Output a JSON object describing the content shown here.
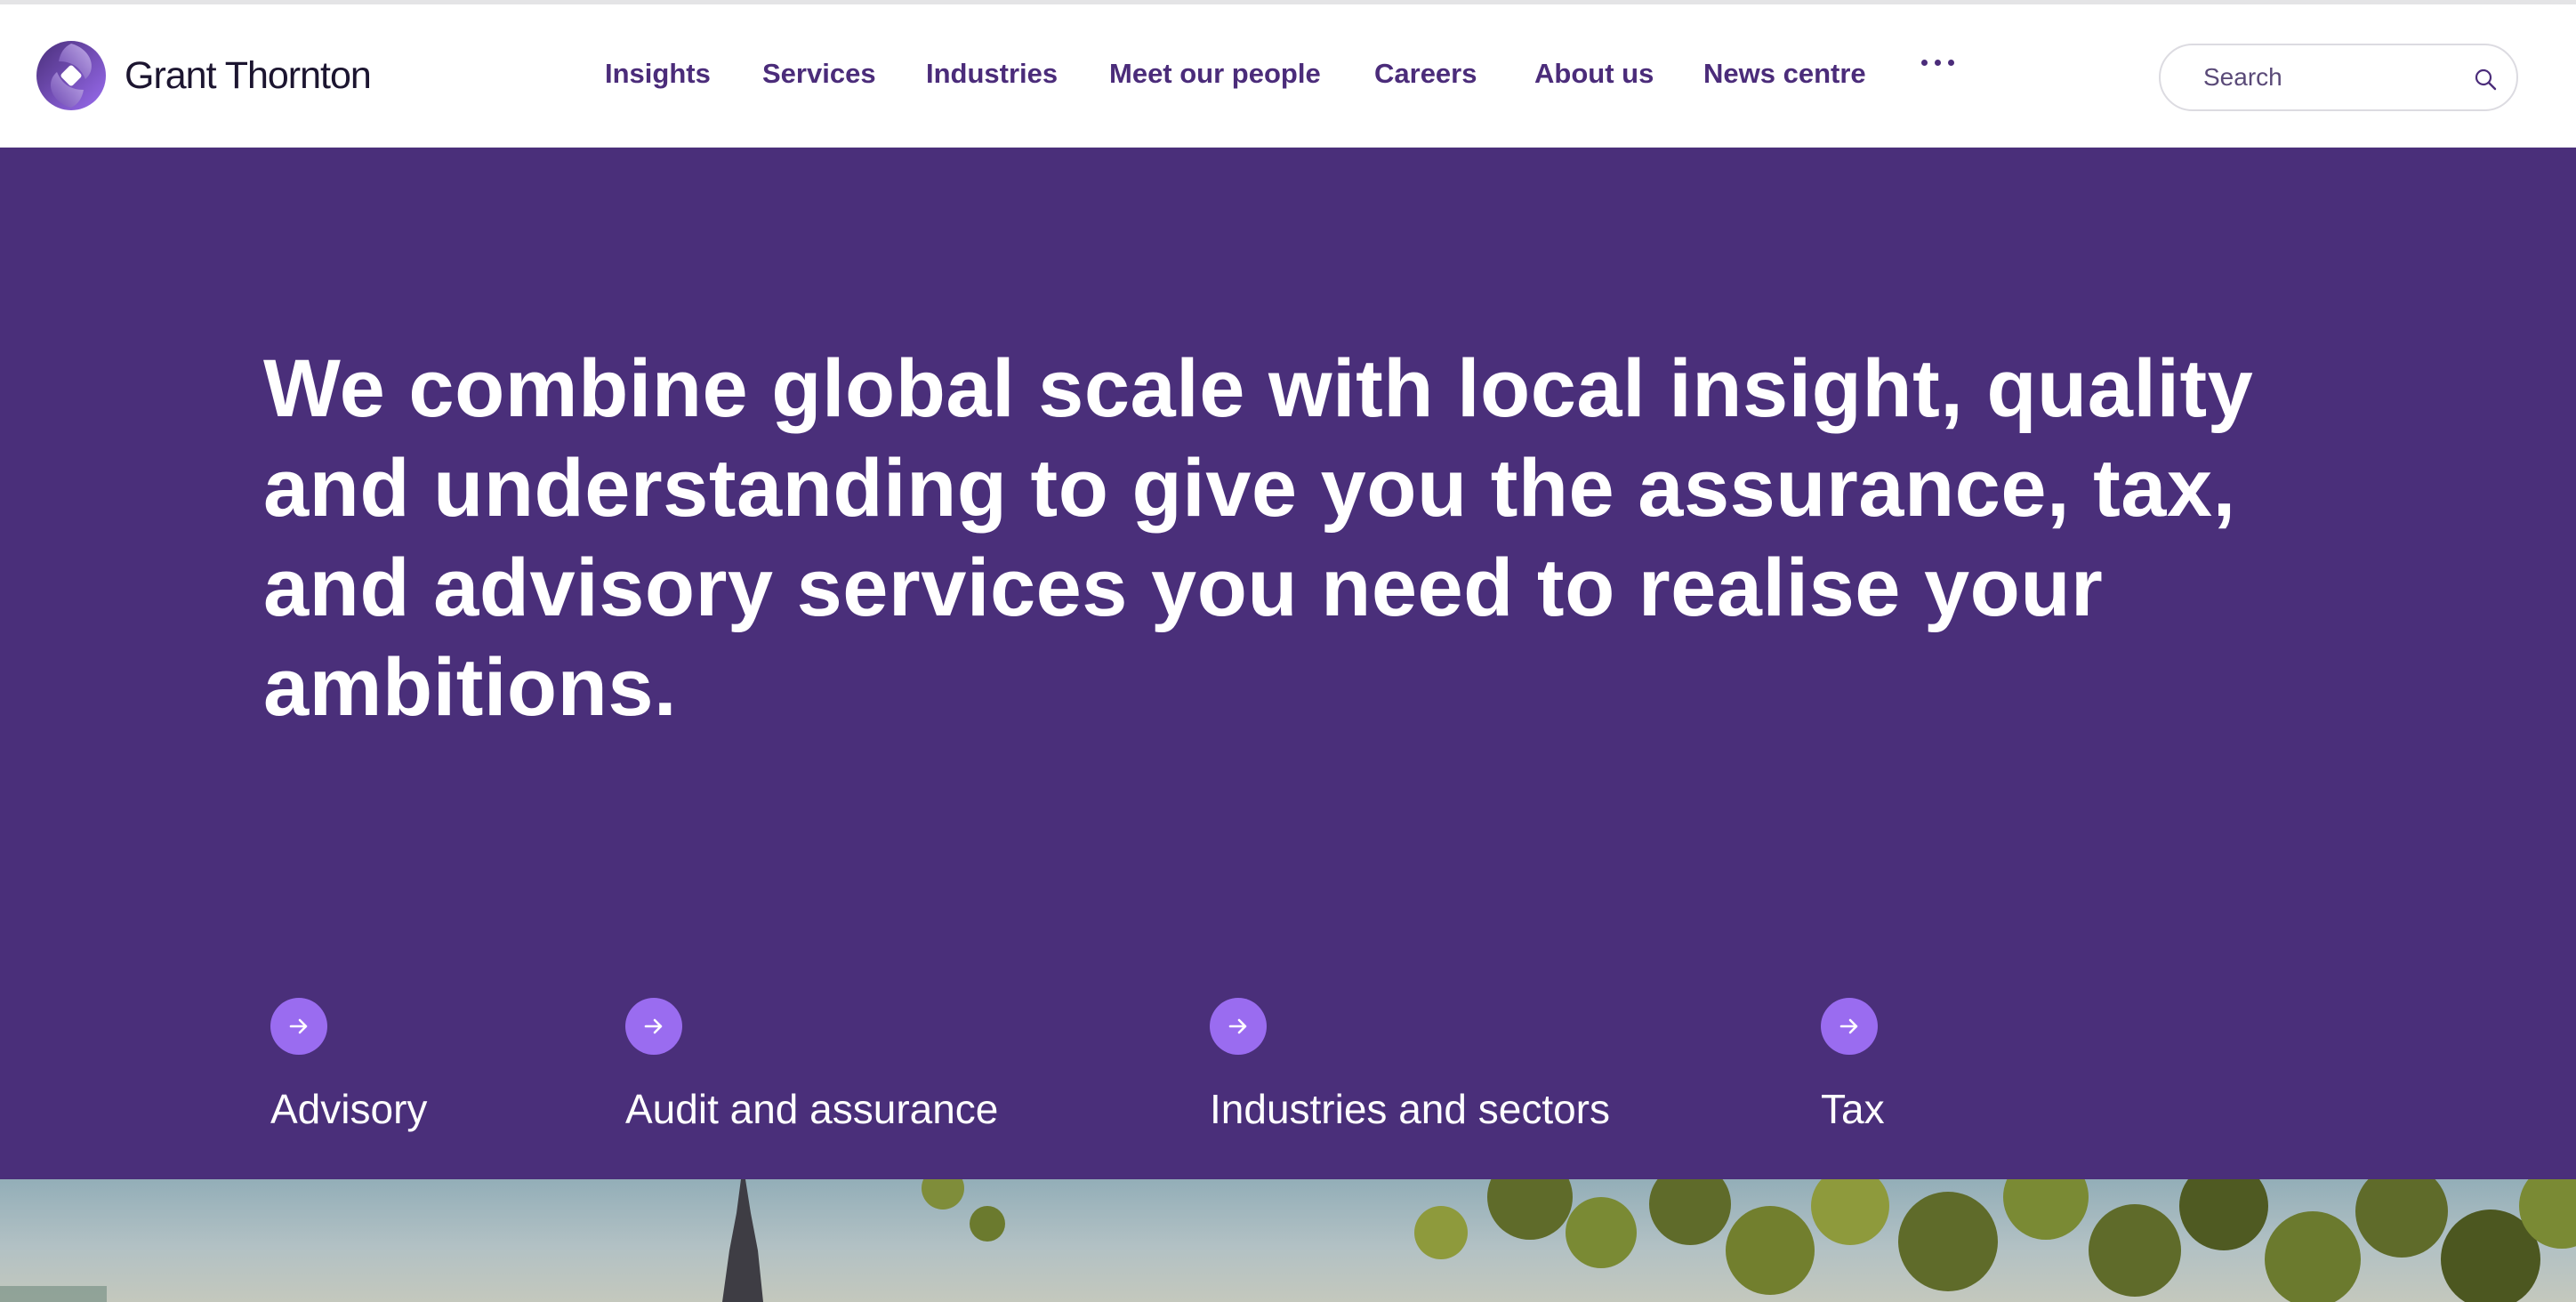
{
  "brand": {
    "name": "Grant Thornton",
    "logo_colors": [
      "#4a2f7a",
      "#9a6cf0",
      "#cbb7ef"
    ]
  },
  "nav": {
    "items": [
      {
        "label": "Insights"
      },
      {
        "label": "Services"
      },
      {
        "label": "Industries"
      },
      {
        "label": "Meet our people"
      },
      {
        "label": "Careers"
      },
      {
        "label": "About us"
      },
      {
        "label": "News centre"
      }
    ],
    "more_icon": "ellipsis-icon"
  },
  "search": {
    "placeholder": "Search",
    "icon": "search-icon"
  },
  "hero": {
    "headline": "We combine global scale with local insight, quality and understanding to give you the assurance, tax, and advisory services you need to realise your ambitions.",
    "links": [
      {
        "label": "Advisory",
        "icon": "arrow-right-icon"
      },
      {
        "label": "Audit and assurance",
        "icon": "arrow-right-icon"
      },
      {
        "label": "Industries and sectors",
        "icon": "arrow-right-icon"
      },
      {
        "label": "Tax",
        "icon": "arrow-right-icon"
      }
    ]
  },
  "colors": {
    "hero_background": "#4a2f7a",
    "accent": "#9a6cf0",
    "nav_text": "#4b2c7a"
  }
}
